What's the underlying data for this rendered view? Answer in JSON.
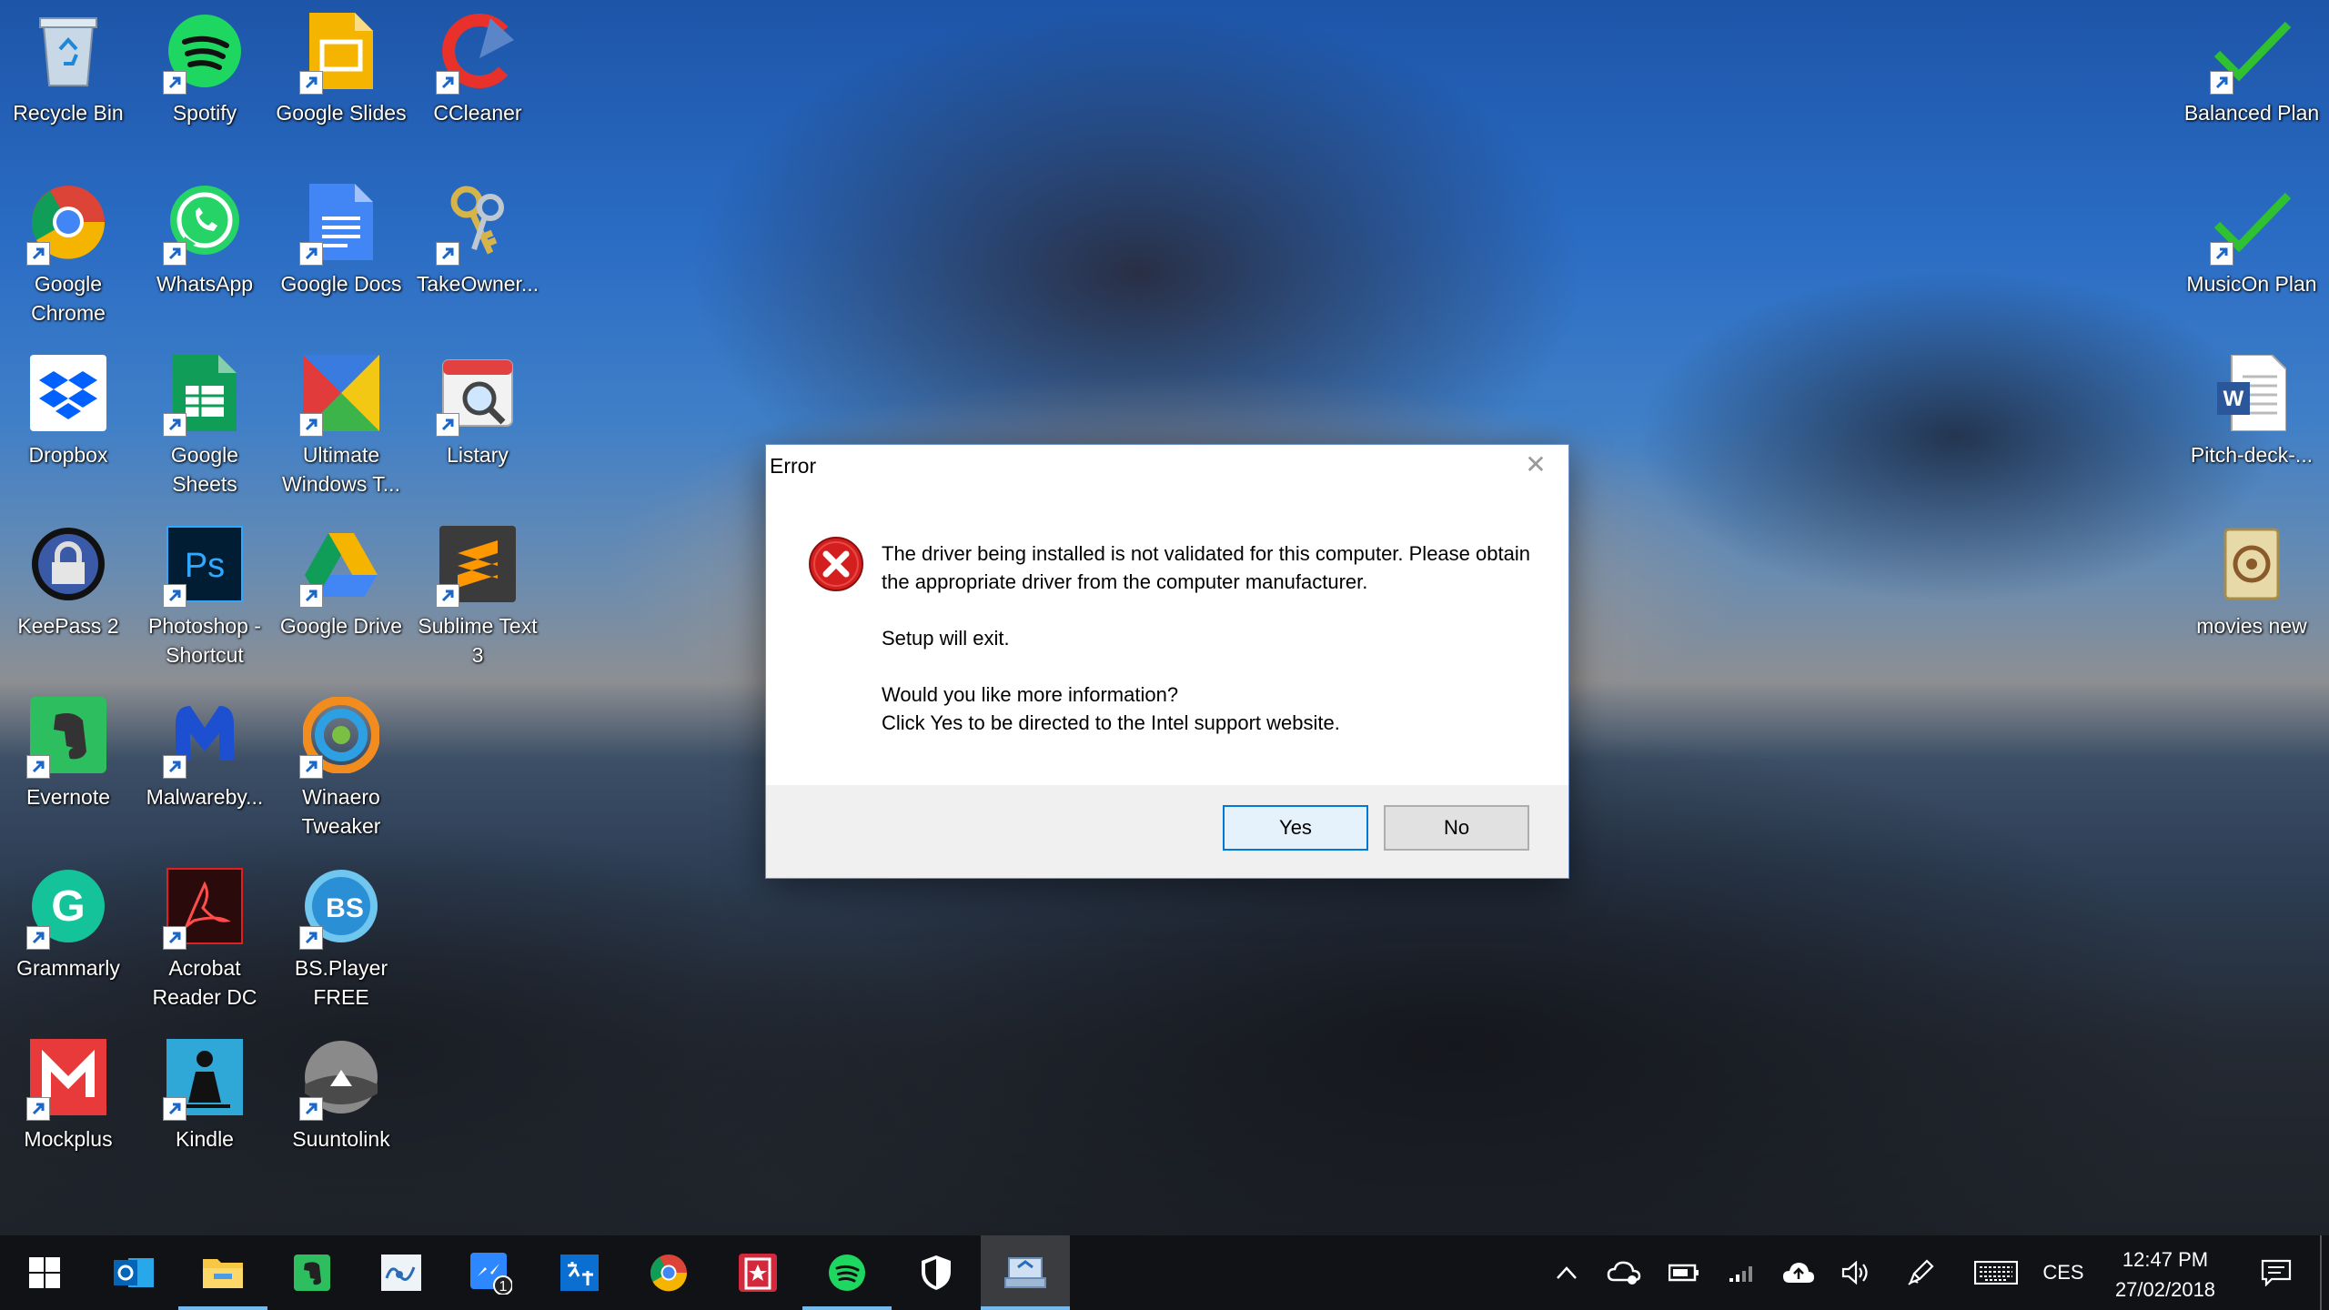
{
  "desktop": {
    "icons": [
      {
        "label": "Recycle Bin"
      },
      {
        "label": "Spotify"
      },
      {
        "label": "Google Slides"
      },
      {
        "label": "CCleaner"
      },
      {
        "label": "Google Chrome"
      },
      {
        "label": "WhatsApp"
      },
      {
        "label": "Google Docs"
      },
      {
        "label": "TakeOwner..."
      },
      {
        "label": "Dropbox"
      },
      {
        "label": "Google Sheets"
      },
      {
        "label": "Ultimate Windows T..."
      },
      {
        "label": "Listary"
      },
      {
        "label": "KeePass 2"
      },
      {
        "label": "Photoshop - Shortcut"
      },
      {
        "label": "Google Drive"
      },
      {
        "label": "Sublime Text 3"
      },
      {
        "label": "Evernote"
      },
      {
        "label": "Malwareby..."
      },
      {
        "label": "Winaero Tweaker"
      },
      {
        "label": "Grammarly"
      },
      {
        "label": "Acrobat Reader DC"
      },
      {
        "label": "BS.Player FREE"
      },
      {
        "label": "Mockplus"
      },
      {
        "label": "Kindle"
      },
      {
        "label": "Suuntolink"
      },
      {
        "label": "Balanced Plan"
      },
      {
        "label": "MusicOn Plan"
      },
      {
        "label": "Pitch-deck-..."
      },
      {
        "label": "movies new"
      }
    ],
    "icon_glyphs": {
      "ps": "Ps",
      "word": "W",
      "bs": "BS",
      "g": "G"
    }
  },
  "dialog": {
    "title": "Error",
    "close": "✕",
    "line1": "The driver being installed is not validated for this computer. Please obtain the appropriate driver from the computer manufacturer.",
    "line2": "Setup will exit.",
    "line3": "Would you like more information?",
    "line4": "Click Yes to be directed to the Intel support website.",
    "yes_label": "Yes",
    "no_label": "No"
  },
  "taskbar": {
    "messenger_badge": "1",
    "language": "CES",
    "time": "12:47 PM",
    "date": "27/02/2018"
  },
  "colors": {
    "accent": "#0078d7",
    "error_red": "#d41f1f",
    "check_green": "#2fc12f",
    "taskbar_bg": "#101216"
  }
}
